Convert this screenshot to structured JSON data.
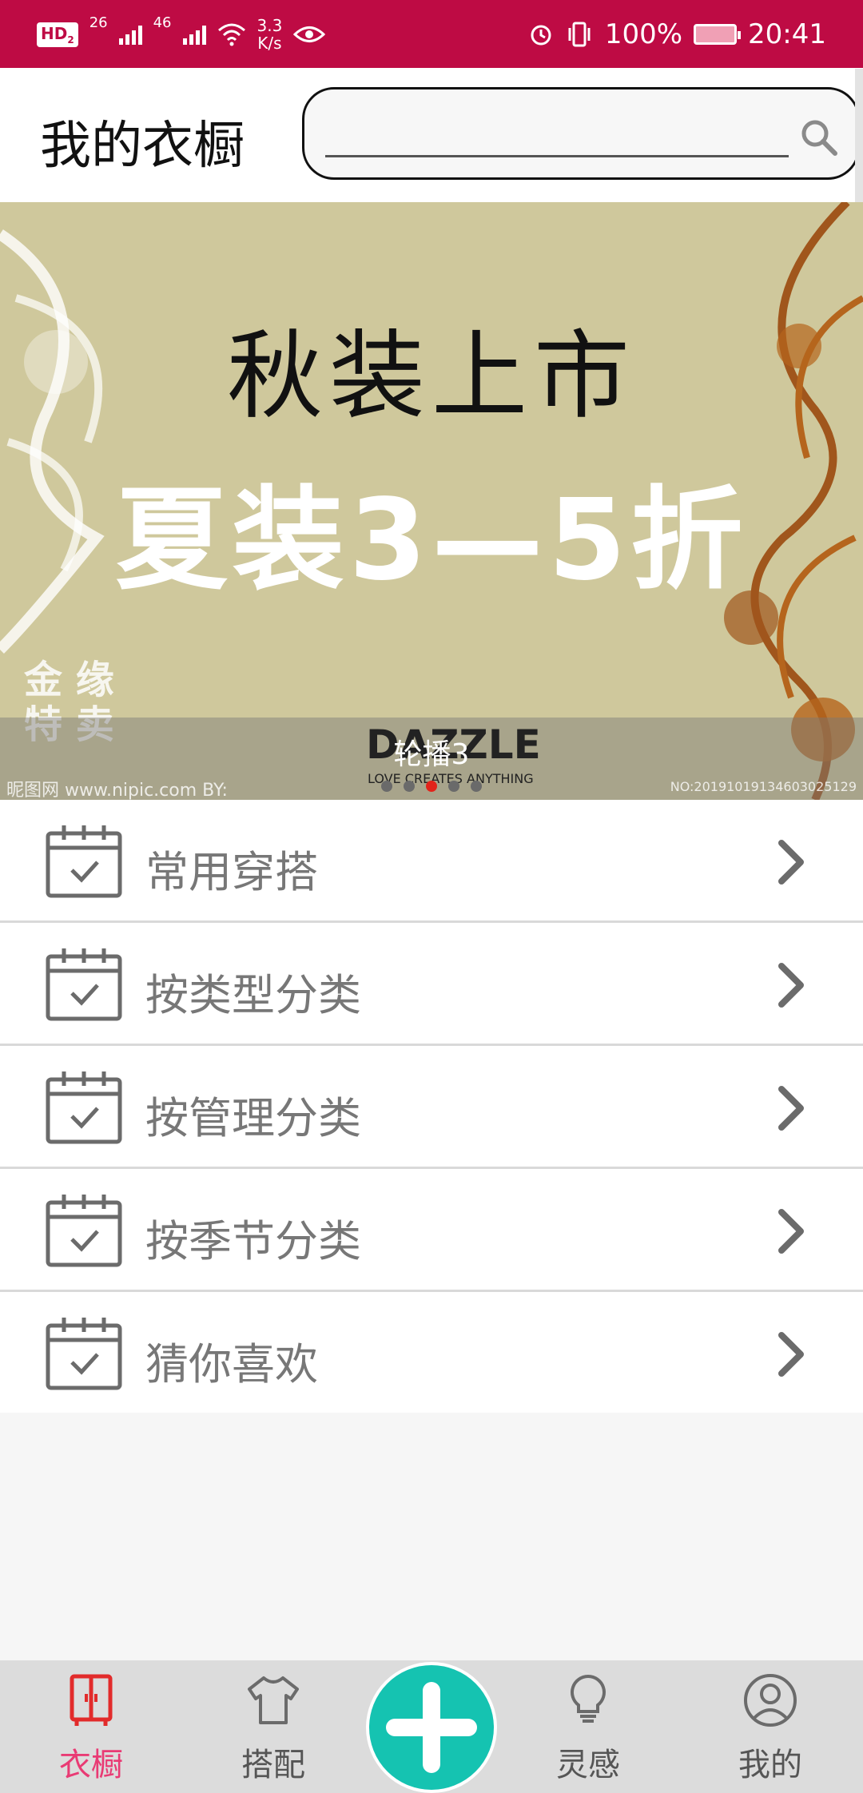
{
  "status_bar": {
    "hd_badge": "HD",
    "hd_sub": "2",
    "net1": "26",
    "net2": "46",
    "speed_value": "3.3",
    "speed_unit": "K/s",
    "battery": "100%",
    "time": "20:41"
  },
  "header": {
    "title": "我的衣橱",
    "search_placeholder": ""
  },
  "banner": {
    "line1": "秋装上市",
    "line2": "夏装3—5折",
    "corner_text_1": "金 缘",
    "corner_text_2": "特 卖",
    "brand": "DAZZLE",
    "brand_tag": "LOVE CREATES ANYTHING",
    "credit_left": "昵图网 www.nipic.com  BY:",
    "credit_right": "NO:20191019134603025129",
    "caption": "轮播3",
    "dot_count": 5,
    "active_dot": 2
  },
  "menu": {
    "items": [
      {
        "label": "常用穿搭",
        "icon": "calendar-check-icon"
      },
      {
        "label": "按类型分类",
        "icon": "calendar-check-icon"
      },
      {
        "label": "按管理分类",
        "icon": "calendar-check-icon"
      },
      {
        "label": "按季节分类",
        "icon": "calendar-check-icon"
      },
      {
        "label": "猜你喜欢",
        "icon": "calendar-check-icon"
      }
    ]
  },
  "tabbar": {
    "tabs": [
      {
        "label": "衣橱",
        "icon": "wardrobe-icon",
        "active": true
      },
      {
        "label": "搭配",
        "icon": "tshirt-icon",
        "active": false
      },
      {
        "label": "灵感",
        "icon": "lightbulb-icon",
        "active": false
      },
      {
        "label": "我的",
        "icon": "profile-icon",
        "active": false
      }
    ],
    "fab_icon": "plus-icon"
  },
  "colors": {
    "status_bar": "#be0b44",
    "active_tab": "#e93a74",
    "fab": "#15c3b1",
    "active_dot": "#e2231a"
  }
}
